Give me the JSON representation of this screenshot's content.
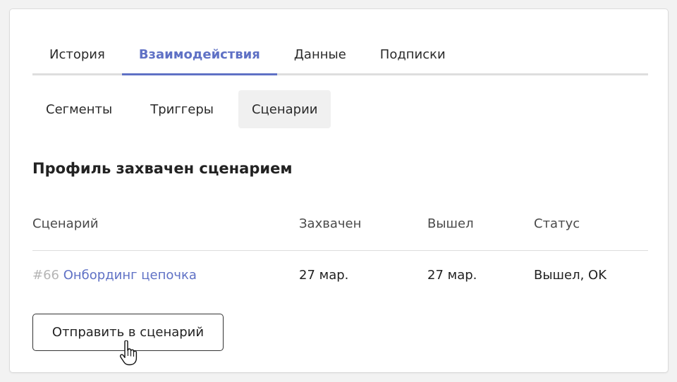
{
  "tabs": [
    {
      "label": "История",
      "active": false
    },
    {
      "label": "Взаимодействия",
      "active": true
    },
    {
      "label": "Данные",
      "active": false
    },
    {
      "label": "Подписки",
      "active": false
    }
  ],
  "subtabs": [
    {
      "label": "Сегменты",
      "active": false
    },
    {
      "label": "Триггеры",
      "active": false
    },
    {
      "label": "Сценарии",
      "active": true
    }
  ],
  "section": {
    "title": "Профиль захвачен сценарием"
  },
  "table": {
    "headers": [
      "Сценарий",
      "Захвачен",
      "Вышел",
      "Статус"
    ],
    "rows": [
      {
        "id": "#66",
        "name": "Онбординг цепочка",
        "captured": "27 мар.",
        "exited": "27 мар.",
        "status": "Вышел, OK"
      }
    ]
  },
  "actions": {
    "send_label": "Отправить в сценарий"
  },
  "colors": {
    "accent": "#5f71c5",
    "muted_id": "#b5b5b5",
    "active_subtab_bg": "#f0f0f0"
  },
  "icons": {
    "cursor": "hand-pointer-icon"
  }
}
